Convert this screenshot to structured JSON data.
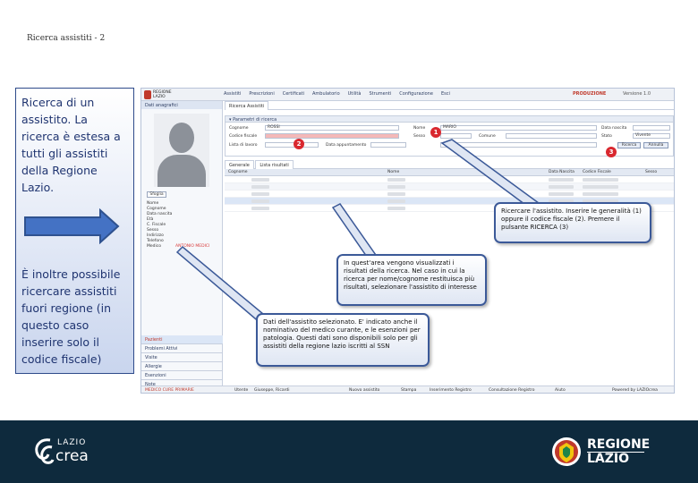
{
  "slide": {
    "title": "Ricerca assistiti - 2"
  },
  "left_panel": {
    "text1": "Ricerca di un assistito. La ricerca è estesa a tutti gli assistiti della Regione Lazio.",
    "text2": "È inoltre possibile ricercare assistiti fuori regione (in questo caso inserire solo il codice fiscale)"
  },
  "app": {
    "logo_line1": "REGIONE",
    "logo_line2": "LAZIO",
    "menu": [
      "Assistiti",
      "Prescrizioni",
      "Certificati",
      "Ambulatorio",
      "Utilità",
      "Strumenti",
      "Configurazione",
      "Esci"
    ],
    "environment": "PRODUZIONE",
    "version": "Versione 1.0",
    "sidebar_header": "Dati anagrafici",
    "photo_button": "Sfoglia",
    "fields": [
      {
        "k": "Nome",
        "v": ""
      },
      {
        "k": "Cognome",
        "v": ""
      },
      {
        "k": "Data nascita",
        "v": ""
      },
      {
        "k": "Età",
        "v": ""
      },
      {
        "k": "C. Fiscale",
        "v": ""
      },
      {
        "k": "Sesso",
        "v": ""
      },
      {
        "k": "Indirizzo",
        "v": ""
      },
      {
        "k": "Telefono",
        "v": ""
      },
      {
        "k": "Medico",
        "v": "ANTONIO MEDICI"
      }
    ],
    "nav": [
      "Pazienti",
      "Problemi Attivi",
      "Visite",
      "Allergie",
      "Esenzioni",
      "Note"
    ],
    "tab": "Ricerca Assistiti",
    "params_header": "Parametri di ricerca",
    "form": {
      "cognome_label": "Cognome",
      "cognome_value": "ROSSI",
      "nome_label": "Nome",
      "nome_value": "MARIO",
      "cf_label": "Codice fiscale",
      "data_label": "Data nascita",
      "sesso_label": "Sesso",
      "stato_label": "Stato",
      "stato_value": "Vivente",
      "comune_label": "Comune",
      "lista_label": "Lista di lavoro",
      "appunt_label": "Data appuntamento",
      "search_button": "Ricerca",
      "reset_button": "Annulla"
    },
    "result_tabs": [
      "Generale",
      "Lista risultati"
    ],
    "columns": [
      "Cognome",
      "Nome",
      "Data Nascita",
      "Codice Fiscale",
      "Sesso"
    ],
    "statusbar": {
      "left": "MEDICO CURE PRIMARIE",
      "user_label": "Utente",
      "user_value": "Giuseppe, Ricardi",
      "items": [
        "Nuovo assistito",
        "Stampa",
        "Inserimento Registro",
        "Consultazione Registro",
        "Aiuto"
      ],
      "right": "Powered by LAZIOcrea"
    }
  },
  "badges": [
    "1",
    "2",
    "3"
  ],
  "callouts": {
    "c1": "Ricercare l'assistito. Inserire le generalità (1) oppure il codice fiscale (2). Premere il pulsante RICERCA (3)",
    "c2": "In quest'area vengono visualizzati i risultati della ricerca. Nel caso in cui la ricerca per nome/cognome restituisca più risultati, selezionare l'assistito di interesse",
    "c3": "Dati dell'assistito selezionato. E' indicato anche il nominativo del medico curante, e le esenzioni per patologia. Questi dati sono disponibili solo per gli assistiti della regione lazio iscritti al SSN"
  },
  "footer": {
    "laziocrea_top": "LAZIO",
    "laziocrea_bottom": "crea",
    "regione_line1": "REGIONE",
    "regione_line2": "LAZIO"
  },
  "colors": {
    "accent": "#1f3470",
    "footer_bg": "#0e2a3d",
    "badge": "#d9282f"
  }
}
